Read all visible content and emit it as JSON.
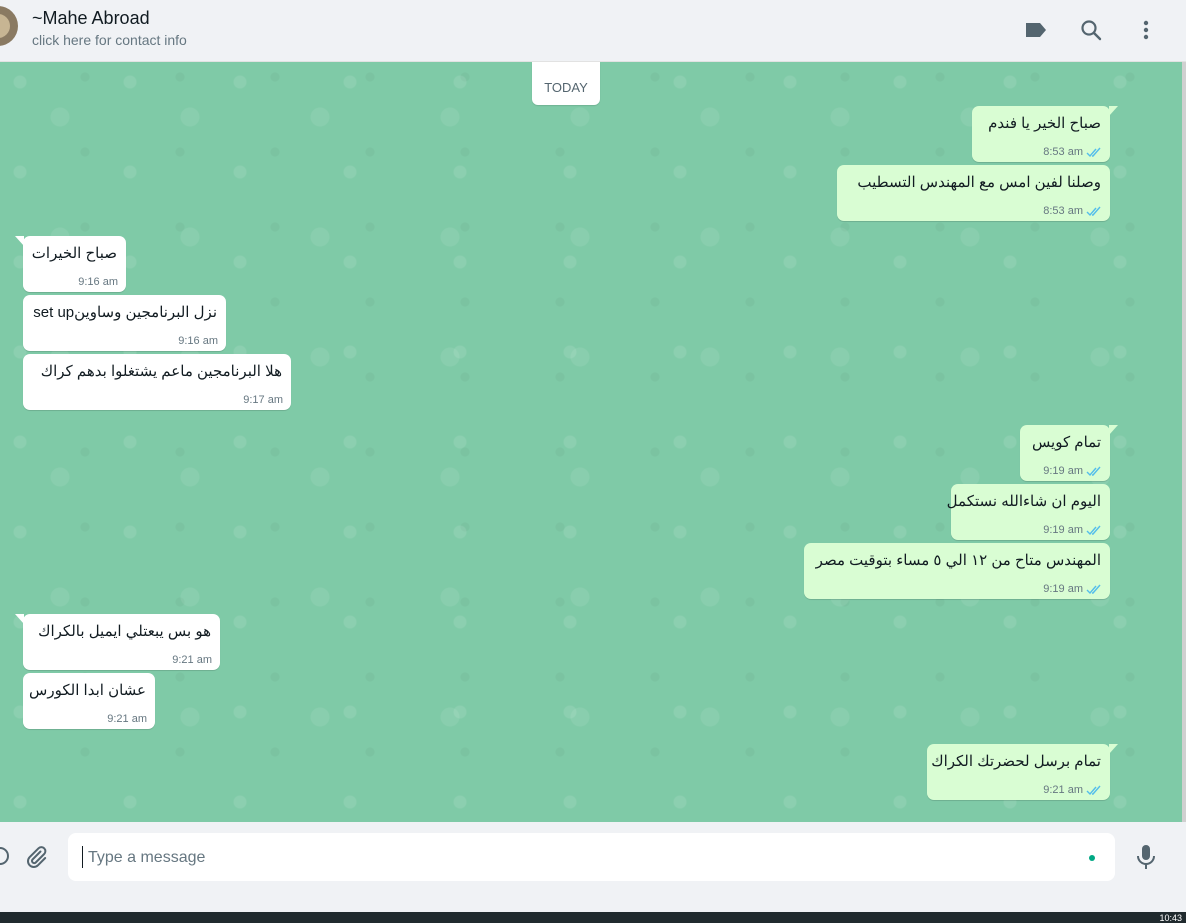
{
  "header": {
    "title": "~Mahe Abroad",
    "subtitle": "click here for contact info",
    "icons": [
      "label-icon",
      "search-icon",
      "menu-dots-icon"
    ]
  },
  "chat": {
    "date_pill": "TODAY",
    "messages": [
      {
        "dir": "out",
        "text": "صباح  الخير يا فندم",
        "time": "8:53 am",
        "status": "read"
      },
      {
        "dir": "out",
        "text": "وصلنا لفين امس مع المهندس التسطيب",
        "time": "8:53 am",
        "status": "read"
      },
      {
        "dir": "in",
        "text": "صباح الخيرات",
        "time": "9:16 am"
      },
      {
        "dir": "in",
        "text": "نزل البرنامجين وساوينset up",
        "time": "9:16 am"
      },
      {
        "dir": "in",
        "text": "هلا البرنامجين ماعم يشتغلوا  بدهم كراك",
        "time": "9:17 am"
      },
      {
        "dir": "out",
        "text": "تمام كويس",
        "time": "9:19 am",
        "status": "read"
      },
      {
        "dir": "out",
        "text": "اليوم ان شاءالله نستكمل",
        "time": "9:19 am",
        "status": "read"
      },
      {
        "dir": "out",
        "text": "المهندس متاح من ١٢ الي ٥ مساء بتوقيت مصر",
        "time": "9:19 am",
        "status": "read"
      },
      {
        "dir": "in",
        "text": "هو بس يبعتلي ايميل بالكراك",
        "time": "9:21 am"
      },
      {
        "dir": "in",
        "text": "عشان ابدا الكورس",
        "time": "9:21 am"
      },
      {
        "dir": "out",
        "text": "تمام برسل لحضرتك الكراك",
        "time": "9:21 am",
        "status": "read"
      }
    ]
  },
  "composer": {
    "placeholder": "Type a message",
    "value": "",
    "icons": [
      "attach-icon",
      "microphone-icon"
    ]
  },
  "colors": {
    "chat_bg": "#7fcaa7",
    "outgoing_bubble": "#d9fdd3",
    "incoming_bubble": "#ffffff",
    "read_ticks": "#53bdeb"
  }
}
